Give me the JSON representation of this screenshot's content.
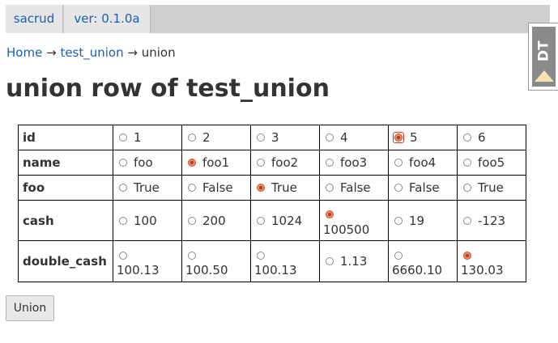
{
  "nav": {
    "brand": "sacrud",
    "version": "ver: 0.1.0a"
  },
  "debug_toolbar": {
    "label": "DT"
  },
  "breadcrumb": {
    "home": "Home",
    "separator": "→",
    "table": "test_union",
    "current": "union"
  },
  "page": {
    "title": "union row of test_union"
  },
  "union_table": {
    "rows": [
      {
        "field": "id",
        "values": [
          "1",
          "2",
          "3",
          "4",
          "5",
          "6"
        ],
        "selected_index": 4,
        "focused_index": 4
      },
      {
        "field": "name",
        "values": [
          "foo",
          "foo1",
          "foo2",
          "foo3",
          "foo4",
          "foo5"
        ],
        "selected_index": 1
      },
      {
        "field": "foo",
        "values": [
          "True",
          "False",
          "True",
          "False",
          "False",
          "True"
        ],
        "selected_index": 2
      },
      {
        "field": "cash",
        "values": [
          "100",
          "200",
          "1024",
          "100500",
          "19",
          "-123"
        ],
        "selected_index": 3
      },
      {
        "field": "double_cash",
        "values": [
          "100.13",
          "100.50",
          "100.13",
          "1.13",
          "6660.10",
          "130.03"
        ],
        "selected_index": 5
      }
    ]
  },
  "form": {
    "submit_label": "Union"
  },
  "colors": {
    "nav_background": "#cfcfcf",
    "nav_tab": "#e6e6e6",
    "link": "#1a5fb4",
    "radio_selected": "#f28a6a",
    "focus_ring": "#d53b1a"
  },
  "icons": {
    "debug_toolbar": "dt-arrow-icon",
    "radio": "radio-button-icon"
  }
}
